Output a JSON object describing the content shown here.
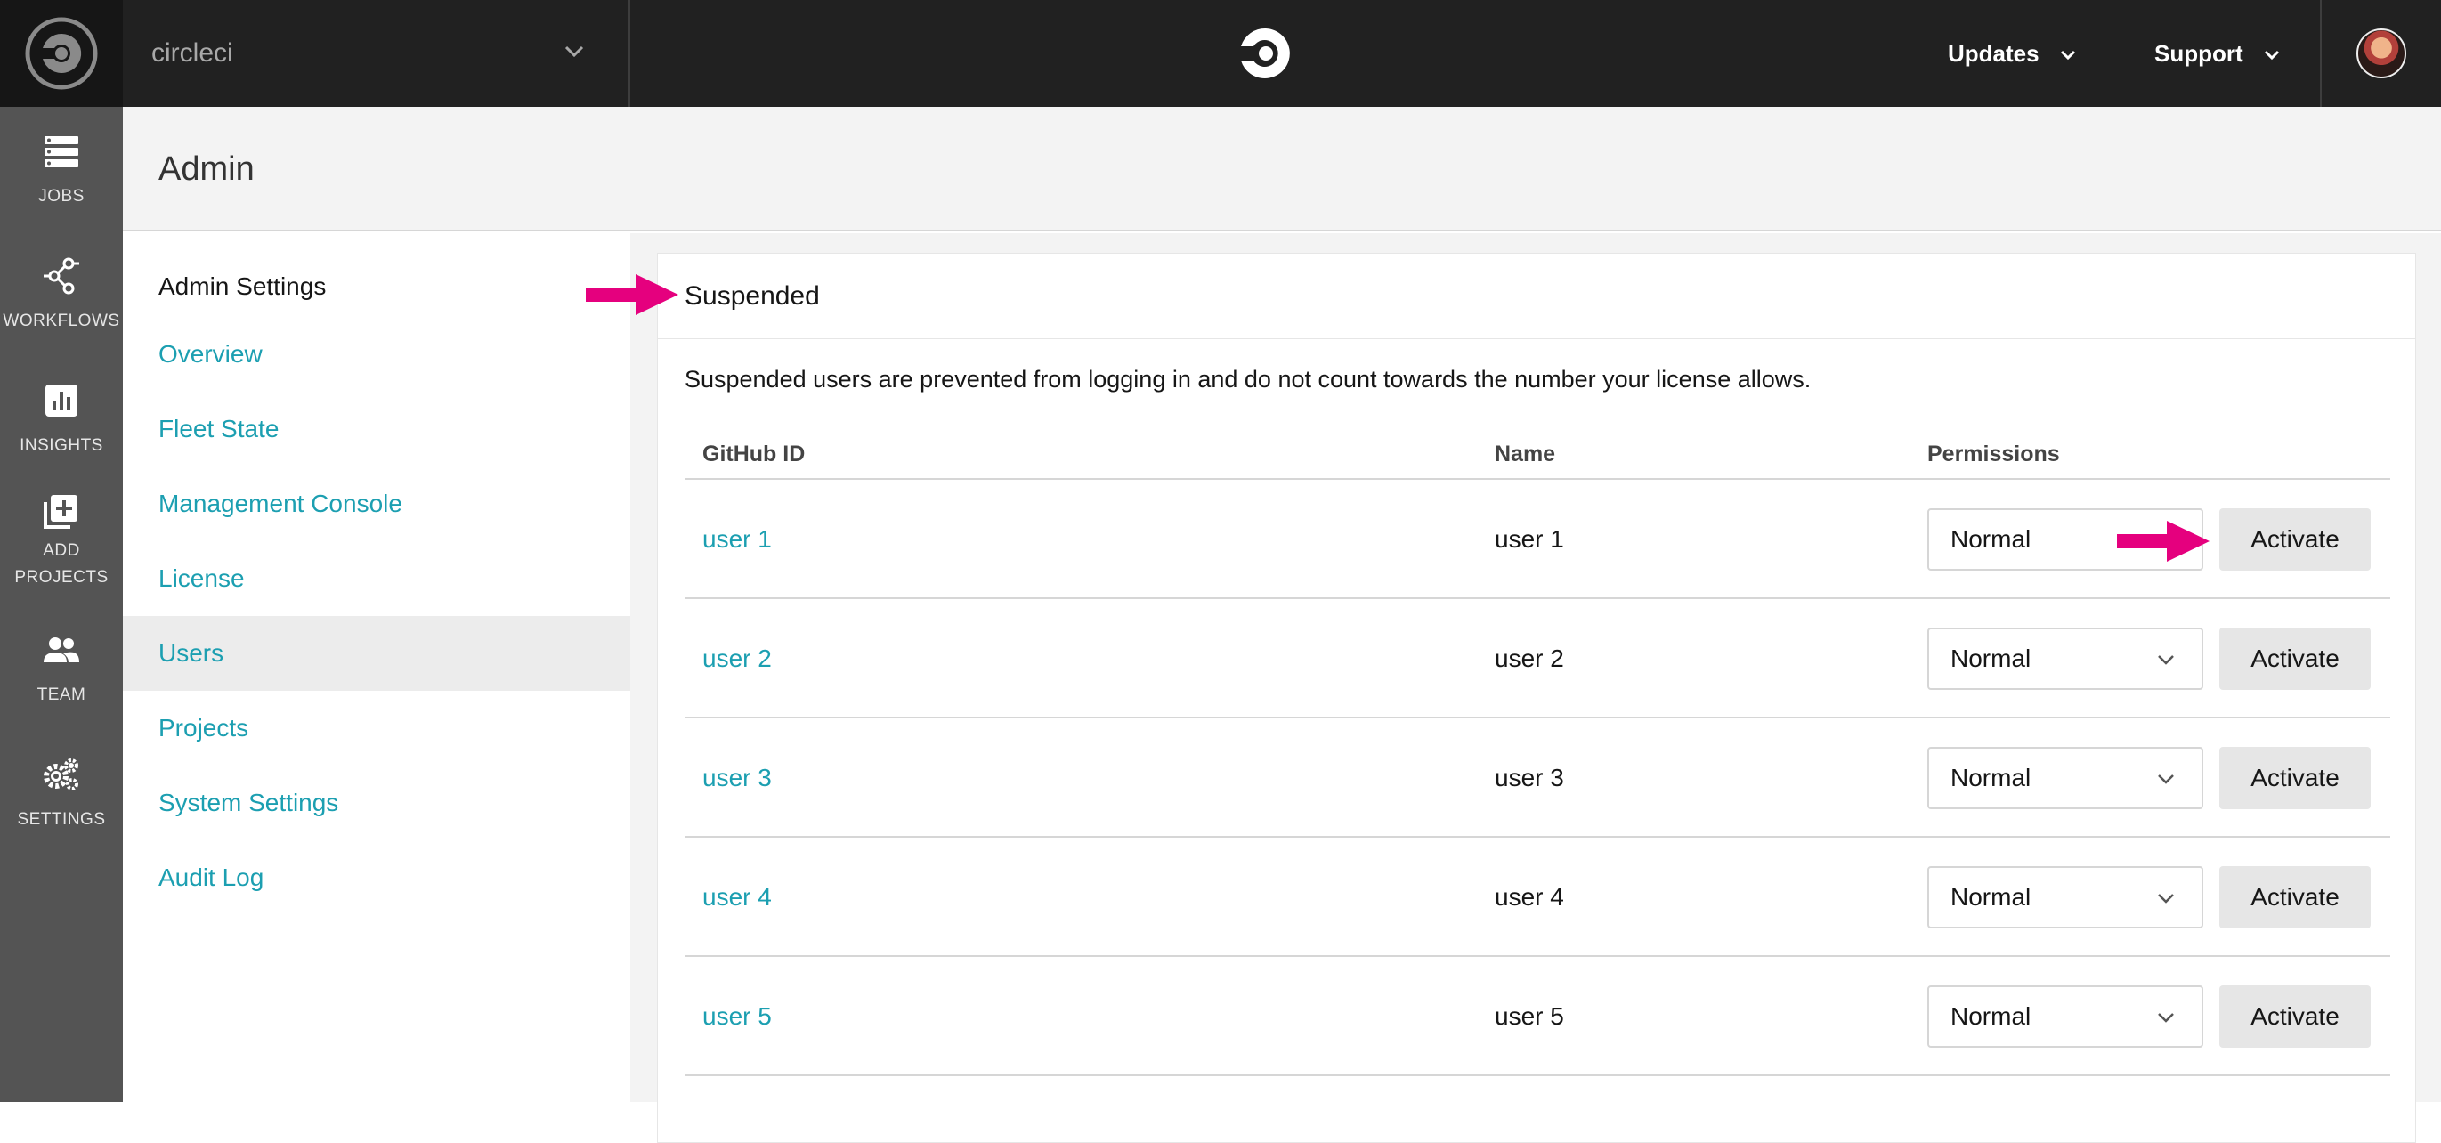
{
  "app": {
    "org_name": "circleci",
    "logo_icon": "circleci-logo-icon",
    "menus": [
      {
        "label": "Updates",
        "icon": "chevron-down-icon"
      },
      {
        "label": "Support",
        "icon": "chevron-down-icon"
      }
    ],
    "avatar": "user-avatar"
  },
  "nav": {
    "items": [
      {
        "label": "JOBS",
        "icon": "jobs-icon"
      },
      {
        "label": "WORKFLOWS",
        "icon": "workflows-icon"
      },
      {
        "label": "INSIGHTS",
        "icon": "insights-icon"
      },
      {
        "label": "ADD PROJECTS",
        "line1": "ADD",
        "line2": "PROJECTS",
        "icon": "add-projects-icon"
      },
      {
        "label": "TEAM",
        "icon": "team-icon"
      },
      {
        "label": "SETTINGS",
        "icon": "settings-icon"
      }
    ]
  },
  "page": {
    "title": "Admin"
  },
  "settings_menu": {
    "heading": "Admin Settings",
    "items": [
      {
        "label": "Overview",
        "active": false
      },
      {
        "label": "Fleet State",
        "active": false
      },
      {
        "label": "Management Console",
        "active": false
      },
      {
        "label": "License",
        "active": false
      },
      {
        "label": "Users",
        "active": true
      },
      {
        "label": "Projects",
        "active": false
      },
      {
        "label": "System Settings",
        "active": false
      },
      {
        "label": "Audit Log",
        "active": false
      }
    ]
  },
  "panel": {
    "title": "Suspended",
    "description": "Suspended users are prevented from logging in and do not count towards the number your license allows.",
    "columns": [
      "GitHub ID",
      "Name",
      "Permissions"
    ],
    "rows": [
      {
        "github_id": "user 1",
        "name": "user 1",
        "permission": "Normal",
        "action": "Activate"
      },
      {
        "github_id": "user 2",
        "name": "user 2",
        "permission": "Normal",
        "action": "Activate"
      },
      {
        "github_id": "user 3",
        "name": "user 3",
        "permission": "Normal",
        "action": "Activate"
      },
      {
        "github_id": "user 4",
        "name": "user 4",
        "permission": "Normal",
        "action": "Activate"
      },
      {
        "github_id": "user 5",
        "name": "user 5",
        "permission": "Normal",
        "action": "Activate"
      }
    ]
  },
  "colors": {
    "topbar": "#212121",
    "leftnav": "#545454",
    "link": "#1c9fb1",
    "annotation_arrow": "#e5007e"
  }
}
